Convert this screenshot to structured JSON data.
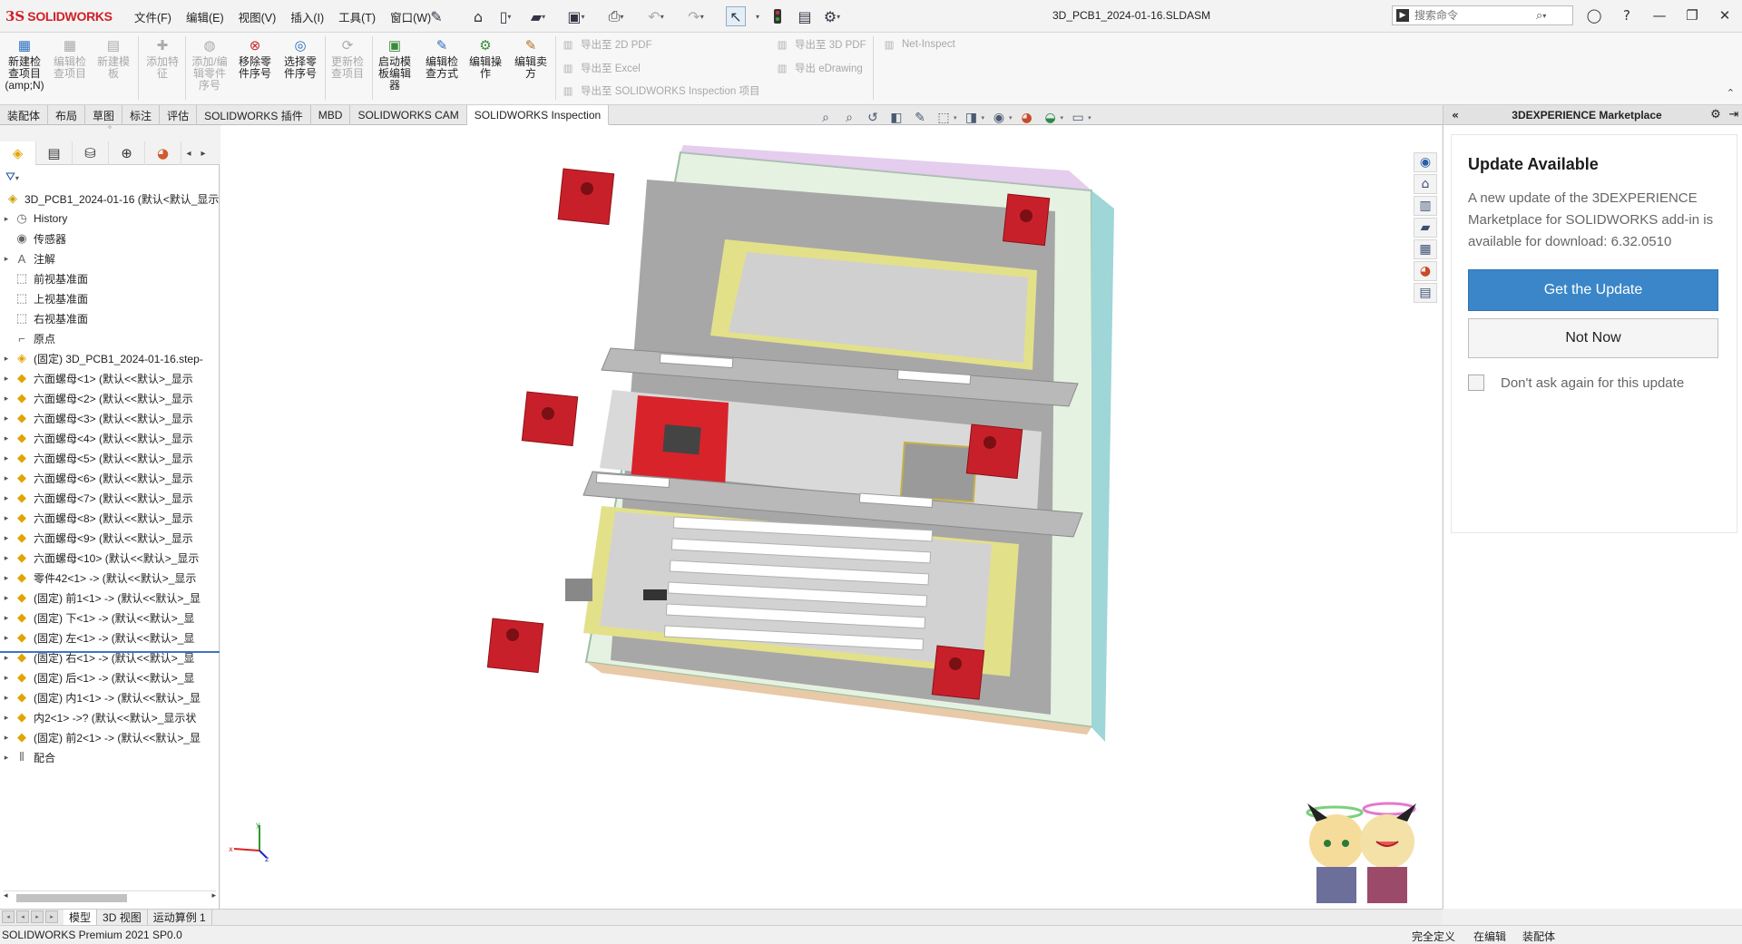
{
  "app": {
    "logo_ds": "3S",
    "logo_name": "SOLIDWORKS",
    "document_title": "3D_PCB1_2024-01-16.SLDASM"
  },
  "menu": [
    "文件(F)",
    "编辑(E)",
    "视图(V)",
    "插入(I)",
    "工具(T)",
    "窗口(W)"
  ],
  "search": {
    "placeholder": "搜索命令"
  },
  "ribbon": {
    "buttons": [
      {
        "label": "新建检查项目 (amp;N)",
        "enabled": true
      },
      {
        "label": "编辑检查项目",
        "enabled": false
      },
      {
        "label": "新建模板",
        "enabled": false
      },
      {
        "label": "添加特征",
        "enabled": false
      },
      {
        "label": "添加/编辑零件序号",
        "enabled": false
      },
      {
        "label": "移除零件序号",
        "enabled": true
      },
      {
        "label": "选择零件序号",
        "enabled": true
      },
      {
        "label": "更新检查项目",
        "enabled": false
      },
      {
        "label": "启动模板编辑器",
        "enabled": true
      },
      {
        "label": "编辑检查方式",
        "enabled": true
      },
      {
        "label": "编辑操作",
        "enabled": true
      },
      {
        "label": "编辑卖方",
        "enabled": true
      }
    ],
    "export_2d_pdf": "导出至 2D PDF",
    "export_excel": "导出至 Excel",
    "export_inspection": "导出至 SOLIDWORKS Inspection 项目",
    "export_3d_pdf": "导出至 3D PDF",
    "export_edrawing": "导出 eDrawing",
    "net_inspect": "Net-Inspect"
  },
  "tabs": [
    {
      "label": "装配体",
      "active": false
    },
    {
      "label": "布局",
      "active": false
    },
    {
      "label": "草图",
      "active": false
    },
    {
      "label": "标注",
      "active": false
    },
    {
      "label": "评估",
      "active": false
    },
    {
      "label": "SOLIDWORKS 插件",
      "active": false
    },
    {
      "label": "MBD",
      "active": false
    },
    {
      "label": "SOLIDWORKS CAM",
      "active": false
    },
    {
      "label": "SOLIDWORKS Inspection",
      "active": true
    }
  ],
  "tree": {
    "root": "3D_PCB1_2024-01-16  (默认<默认_显示",
    "items": [
      {
        "label": "History",
        "icon": "history-icon",
        "expand": true
      },
      {
        "label": "传感器",
        "icon": "sensor-icon",
        "expand": false
      },
      {
        "label": "注解",
        "icon": "annotation-icon",
        "expand": true
      },
      {
        "label": "前视基准面",
        "icon": "plane-icon",
        "expand": false
      },
      {
        "label": "上视基准面",
        "icon": "plane-icon",
        "expand": false
      },
      {
        "label": "右视基准面",
        "icon": "plane-icon",
        "expand": false
      },
      {
        "label": "原点",
        "icon": "origin-icon",
        "expand": false
      },
      {
        "label": "(固定) 3D_PCB1_2024-01-16.step-",
        "icon": "subassembly-icon",
        "expand": true
      },
      {
        "label": "六面螺母<1> (默认<<默认>_显示",
        "icon": "part-icon",
        "expand": true
      },
      {
        "label": "六面螺母<2> (默认<<默认>_显示",
        "icon": "part-icon",
        "expand": true
      },
      {
        "label": "六面螺母<3> (默认<<默认>_显示",
        "icon": "part-icon",
        "expand": true
      },
      {
        "label": "六面螺母<4> (默认<<默认>_显示",
        "icon": "part-icon",
        "expand": true
      },
      {
        "label": "六面螺母<5> (默认<<默认>_显示",
        "icon": "part-icon",
        "expand": true
      },
      {
        "label": "六面螺母<6> (默认<<默认>_显示",
        "icon": "part-icon",
        "expand": true
      },
      {
        "label": "六面螺母<7> (默认<<默认>_显示",
        "icon": "part-icon",
        "expand": true
      },
      {
        "label": "六面螺母<8> (默认<<默认>_显示",
        "icon": "part-icon",
        "expand": true
      },
      {
        "label": "六面螺母<9> (默认<<默认>_显示",
        "icon": "part-icon",
        "expand": true
      },
      {
        "label": "六面螺母<10> (默认<<默认>_显示",
        "icon": "part-icon",
        "expand": true
      },
      {
        "label": "零件42<1> -> (默认<<默认>_显示",
        "icon": "part-icon",
        "expand": true
      },
      {
        "label": "(固定) 前1<1> -> (默认<<默认>_显",
        "icon": "part-icon",
        "expand": true
      },
      {
        "label": "(固定) 下<1> -> (默认<<默认>_显",
        "icon": "part-icon",
        "expand": true
      },
      {
        "label": "(固定) 左<1> -> (默认<<默认>_显",
        "icon": "part-icon",
        "expand": true
      },
      {
        "label": "(固定) 右<1> -> (默认<<默认>_显",
        "icon": "part-icon",
        "expand": true
      },
      {
        "label": "(固定) 后<1> -> (默认<<默认>_显",
        "icon": "part-icon",
        "expand": true
      },
      {
        "label": "(固定) 内1<1> -> (默认<<默认>_显",
        "icon": "part-icon",
        "expand": true
      },
      {
        "label": "内2<1> ->? (默认<<默认>_显示状",
        "icon": "part-icon",
        "expand": true
      },
      {
        "label": "(固定) 前2<1> -> (默认<<默认>_显",
        "icon": "part-icon",
        "expand": true
      },
      {
        "label": "配合",
        "icon": "mates-icon",
        "expand": true
      }
    ]
  },
  "marketplace": {
    "header": "3DEXPERIENCE Marketplace",
    "title": "Update Available",
    "message": "A new update of the 3DEXPERIENCE Marketplace for SOLIDWORKS add-in is available for download: 6.32.0510",
    "primary_button": "Get the Update",
    "secondary_button": "Not Now",
    "checkbox_label": "Don't ask again for this update"
  },
  "bottom_tabs": [
    {
      "label": "模型",
      "active": true
    },
    {
      "label": "3D 视图",
      "active": false
    },
    {
      "label": "运动算例 1",
      "active": false
    }
  ],
  "status": {
    "version": "SOLIDWORKS Premium 2021 SP0.0",
    "definition": "完全定义",
    "editing": "在编辑",
    "mode": "装配体"
  },
  "triad": {
    "x": "x",
    "y": "y",
    "z": "z"
  },
  "colors": {
    "brand_red": "#d21f26",
    "accent_blue": "#3a86c8",
    "pcb_red": "#d8232a",
    "nut_red": "#c8202a",
    "enclosure_gray": "#a5a5a5"
  }
}
